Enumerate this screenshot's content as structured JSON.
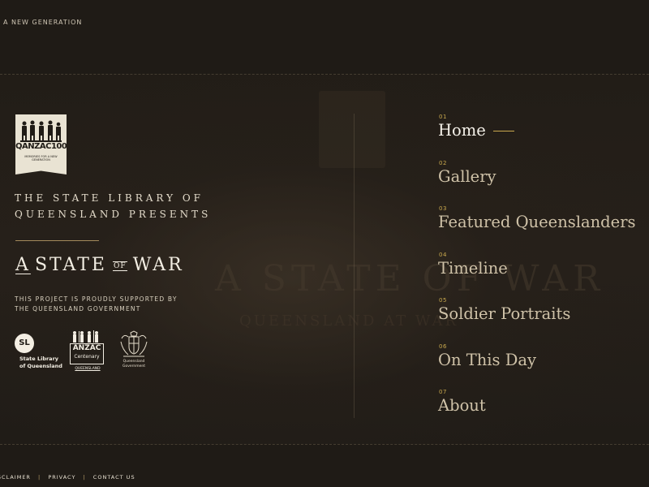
{
  "header": {
    "tagline": "A NEW GENERATION"
  },
  "logo": {
    "title": "QANZAC100",
    "subtitle": "MEMORIES FOR A NEW GENERATION"
  },
  "intro": {
    "line1": "THE STATE LIBRARY OF",
    "line2": "QUEENSLAND PRESENTS",
    "title_a": "A",
    "title_state": "STATE",
    "title_of": "OF",
    "title_war": "WAR",
    "support_line1": "THIS PROJECT IS PROUDLY SUPPORTED BY",
    "support_line2": "THE QUEENSLAND GOVERNMENT"
  },
  "partners": {
    "sl_mark": "SL",
    "sl_line1": "State Library",
    "sl_line2": "of Queensland",
    "anzac_line1": "ANZAC",
    "anzac_line2": "Centenary",
    "anzac_line3": "QUEENSLAND",
    "qld_line1": "Queensland",
    "qld_line2": "Government"
  },
  "nav": {
    "items": [
      {
        "num": "01",
        "label": "Home",
        "active": true
      },
      {
        "num": "02",
        "label": "Gallery"
      },
      {
        "num": "03",
        "label": "Featured Queenslanders"
      },
      {
        "num": "04",
        "label": "Timeline"
      },
      {
        "num": "05",
        "label": "Soldier Portraits"
      },
      {
        "num": "06",
        "label": "On This Day"
      },
      {
        "num": "07",
        "label": "About"
      }
    ]
  },
  "footer": {
    "links": [
      "DISCLAIMER",
      "PRIVACY",
      "CONTACT US"
    ],
    "separator": "|"
  },
  "colors": {
    "accent": "#c9a94e",
    "background": "#1f1b16",
    "text": "#e8e1d2"
  }
}
